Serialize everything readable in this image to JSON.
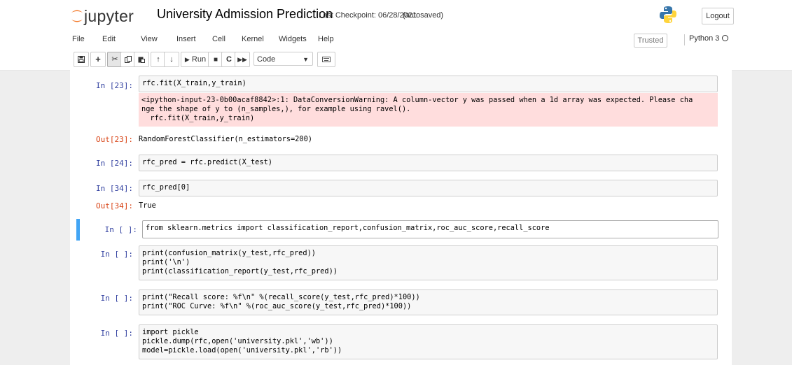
{
  "header": {
    "logo_text": "jupyter",
    "notebook_title": "University Admission Prediction",
    "checkpoint": "Last Checkpoint: 06/28/2021",
    "autosave": "(autosaved)",
    "logout_label": "Logout"
  },
  "menu": {
    "items": [
      "File",
      "Edit",
      "View",
      "Insert",
      "Cell",
      "Kernel",
      "Widgets",
      "Help"
    ],
    "trusted_label": "Trusted",
    "kernel_name": "Python 3"
  },
  "toolbar": {
    "run_label": "Run",
    "cell_type": "Code",
    "icons": [
      "save-icon",
      "add-cell-icon",
      "cut-icon",
      "copy-icon",
      "paste-icon",
      "move-up-icon",
      "move-down-icon",
      "run-icon",
      "stop-icon",
      "restart-icon",
      "fast-forward-icon",
      "keyboard-icon"
    ]
  },
  "cells": [
    {
      "prompt": "In [23]:",
      "code": "rfc.fit(X_train,y_train)",
      "stderr": "<ipython-input-23-0b00acaf8842>:1: DataConversionWarning: A column-vector y was passed when a 1d array was expected. Please cha\nnge the shape of y to (n_samples,), for example using ravel().\n  rfc.fit(X_train,y_train)",
      "out_prompt": "Out[23]:",
      "output": "RandomForestClassifier(n_estimators=200)"
    },
    {
      "prompt": "In [24]:",
      "code": "rfc_pred = rfc.predict(X_test)"
    },
    {
      "prompt": "In [34]:",
      "code": "rfc_pred[0]",
      "out_prompt": "Out[34]:",
      "output": "True"
    },
    {
      "prompt": "In [ ]:",
      "code": "from sklearn.metrics import classification_report,confusion_matrix,roc_auc_score,recall_score"
    },
    {
      "prompt": "In [ ]:",
      "code": "print(confusion_matrix(y_test,rfc_pred))\nprint('\\n')\nprint(classification_report(y_test,rfc_pred))"
    },
    {
      "prompt": "In [ ]:",
      "code": "print(\"Recall score: %f\\n\" %(recall_score(y_test,rfc_pred)*100))\nprint(\"ROC Curve: %f\\n\" %(roc_auc_score(y_test,rfc_pred)*100))"
    },
    {
      "prompt": "In [ ]:",
      "code": "import pickle\npickle.dump(rfc,open('university.pkl','wb'))\nmodel=pickle.load(open('university.pkl','rb'))"
    }
  ],
  "colors": {
    "in_prompt": "#303f9f",
    "out_prompt": "#d84315",
    "selected_bar": "#42a5f5",
    "stderr_bg": "#ffdddd"
  }
}
